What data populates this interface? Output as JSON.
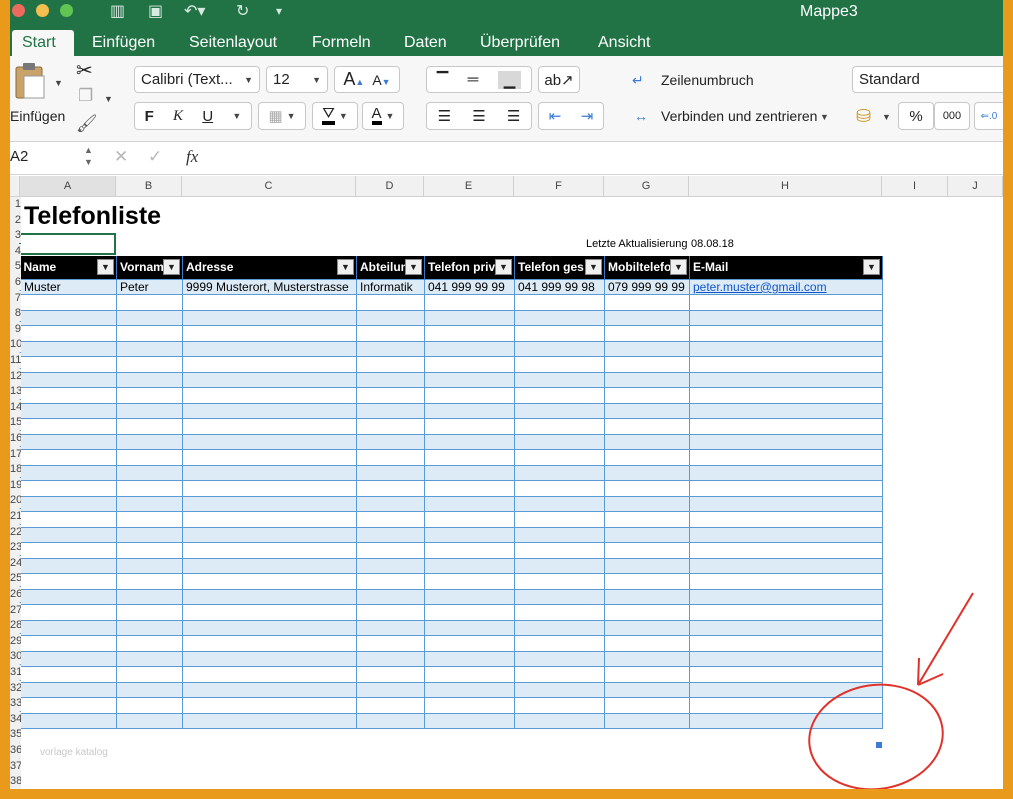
{
  "window": {
    "title": "Mappe3"
  },
  "tabs": [
    "Start",
    "Einfügen",
    "Seitenlayout",
    "Formeln",
    "Daten",
    "Überprüfen",
    "Ansicht"
  ],
  "ribbon": {
    "paste_label": "Einfügen",
    "font_name": "Calibri (Text...",
    "font_size": "12",
    "grow_font": "A",
    "shrink_font": "A",
    "bold": "F",
    "italic": "K",
    "underline": "U",
    "font_color": "A",
    "wrap_text": "Zeilenumbruch",
    "merge_center": "Verbinden und zentrieren",
    "number_format": "Standard",
    "percent": "%",
    "thousands": "000"
  },
  "formula_bar": {
    "name_box": "A2",
    "fx": "fx",
    "cancel": "✕",
    "confirm": "✓"
  },
  "columns": [
    "A",
    "B",
    "C",
    "D",
    "E",
    "F",
    "G",
    "H",
    "I",
    "J"
  ],
  "sheet": {
    "title": "Telefonliste",
    "last_update_label": "Letzte Aktualisierung",
    "last_update_value": "08.08.18",
    "headers": [
      "Name",
      "Vornam",
      "Adresse",
      "Abteilun",
      "Telefon priv",
      "Telefon ges",
      "Mobiltelefo",
      "E-Mail"
    ],
    "rows": [
      [
        "Muster",
        "Peter",
        "9999 Musterort, Musterstrasse",
        "Informatik",
        "041 999 99 99",
        "041 999 99 98",
        "079 999 99 99",
        "peter.muster@gmail.com"
      ]
    ],
    "watermark": "vorlage katalog"
  },
  "colors": {
    "accent": "#217346",
    "table_stripe": "#ddebf7",
    "table_border": "#5b9bd5",
    "annotation": "#e0322b"
  },
  "icons": [
    "scissors-icon",
    "copy-icon",
    "format-painter-icon",
    "paste-icon",
    "fill-color-icon",
    "borders-icon",
    "currency-icon",
    "filter-arrow-icon"
  ]
}
